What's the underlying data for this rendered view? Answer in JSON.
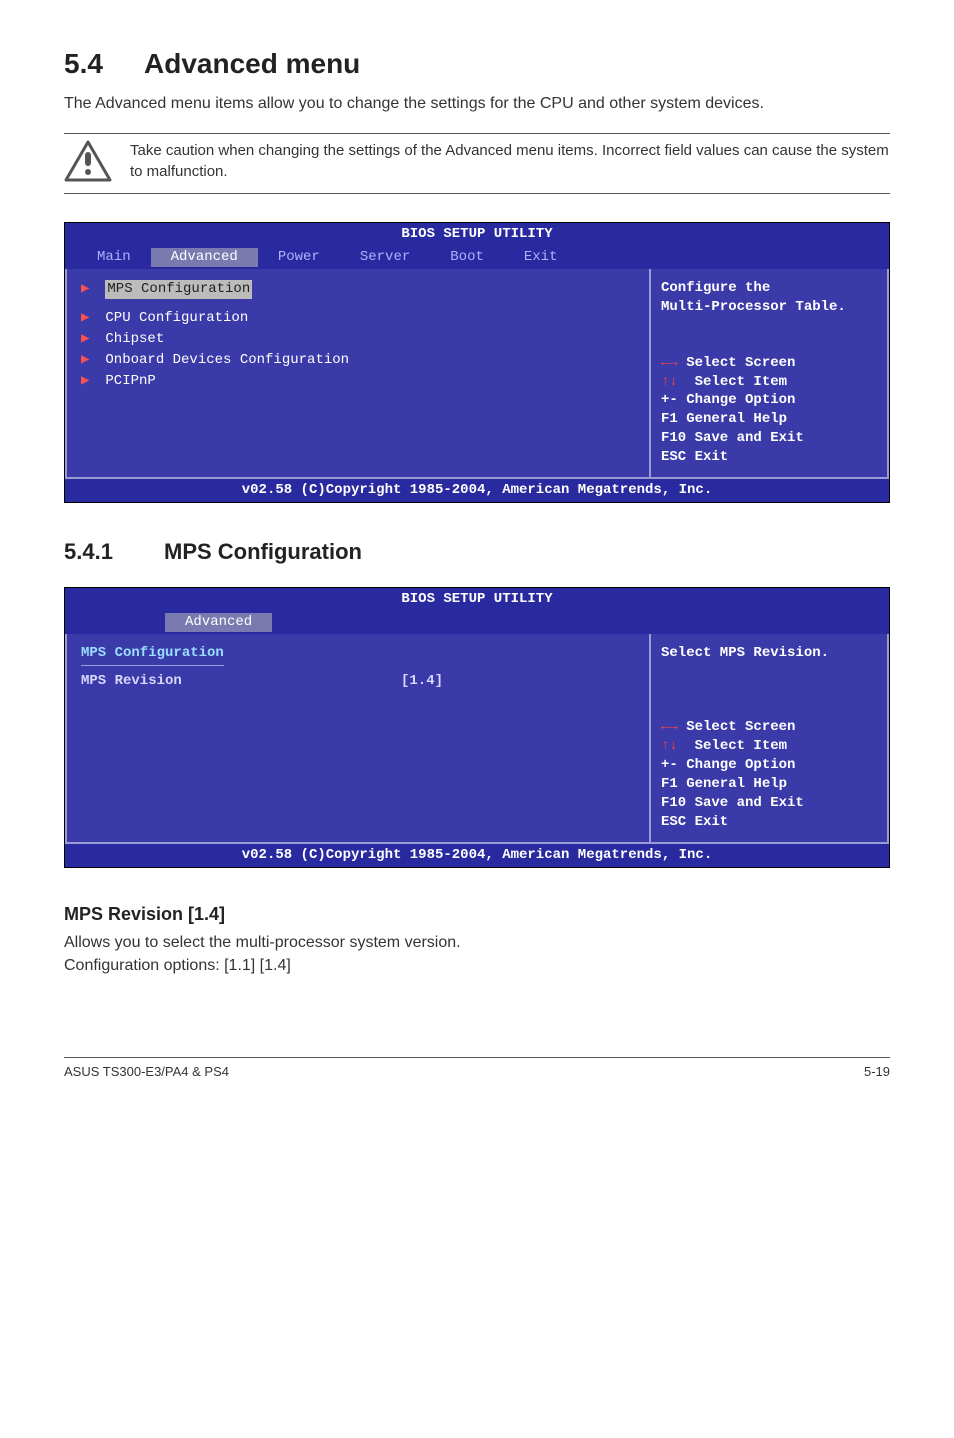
{
  "heading": {
    "num": "5.4",
    "title": "Advanced menu"
  },
  "lead": "The Advanced menu items allow you to change the settings for the CPU and other system devices.",
  "note": "Take caution when changing the settings of the Advanced menu items. Incorrect field values can cause the system to malfunction.",
  "bios1": {
    "title": "BIOS SETUP UTILITY",
    "tabs": [
      "Main",
      "Advanced",
      "Power",
      "Server",
      "Boot",
      "Exit"
    ],
    "selected_tab": "Advanced",
    "menu_selected": "MPS Configuration",
    "menu_items": [
      "CPU Configuration",
      "Chipset",
      "Onboard Devices Configuration",
      "PCIPnP"
    ],
    "help1": "Configure the",
    "help2": "Multi-Processor Table.",
    "keys": [
      "←→ Select Screen",
      "↑↓  Select Item",
      "+-  Change Option",
      "F1  General Help",
      "F10 Save and Exit",
      "ESC Exit"
    ],
    "footer": "v02.58 (C)Copyright 1985-2004, American Megatrends, Inc."
  },
  "subheading": {
    "num": "5.4.1",
    "title": "MPS Configuration"
  },
  "bios2": {
    "title": "BIOS SETUP UTILITY",
    "tab": "Advanced",
    "section": "MPS Configuration",
    "field_name": "MPS Revision",
    "field_value": "[1.4]",
    "help": "Select MPS Revision.",
    "keys": [
      "←→ Select Screen",
      "↑↓  Select Item",
      "+-  Change Option",
      "F1  General Help",
      "F10 Save and Exit",
      "ESC Exit"
    ],
    "footer": "v02.58 (C)Copyright 1985-2004, American Megatrends, Inc."
  },
  "mps_heading": "MPS Revision [1.4]",
  "mps_body1": "Allows you to select the multi-processor system version.",
  "mps_body2": "Configuration options: [1.1] [1.4]",
  "footer_left": "ASUS TS300-E3/PA4 & PS4",
  "footer_right": "5-19"
}
